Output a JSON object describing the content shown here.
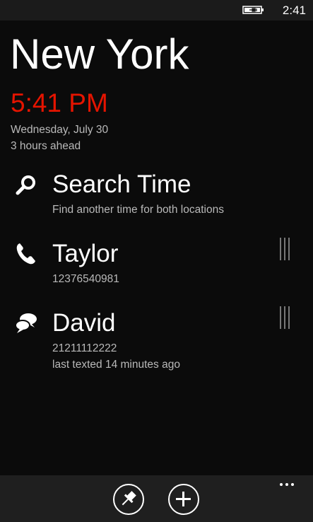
{
  "status_bar": {
    "time": "2:41",
    "battery_icon": "battery-charging-icon"
  },
  "location": {
    "city": "New York",
    "time": "5:41 PM",
    "date": "Wednesday, July 30",
    "offset": "3 hours ahead",
    "time_color": "#e51400"
  },
  "items": [
    {
      "icon": "search-icon",
      "title": "Search Time",
      "subtitle": "Find another time for both locations"
    },
    {
      "icon": "phone-icon",
      "title": "Taylor",
      "subtitle": "12376540981"
    },
    {
      "icon": "message-icon",
      "title": "David",
      "subtitle": "21211112222",
      "detail": "last texted 14 minutes ago"
    }
  ],
  "app_bar": {
    "buttons": [
      "pin-icon",
      "add-icon"
    ],
    "more_icon": "more-icon"
  }
}
